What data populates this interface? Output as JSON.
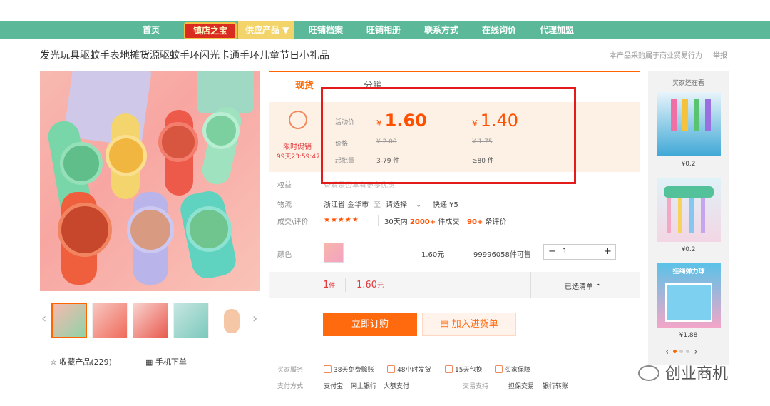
{
  "nav": {
    "home": "首页",
    "shop_treasure": "镇店之宝",
    "supply": "供应产品 ▼",
    "archive": "旺铺档案",
    "album": "旺铺相册",
    "contact": "联系方式",
    "inquiry": "在线询价",
    "agent": "代理加盟"
  },
  "product": {
    "title": "发光玩具驱蚊手表地摊货源驱蚊手环闪光卡通手环儿童节日小礼品",
    "note": "本产品采购属于商业贸易行为",
    "report": "举报"
  },
  "tabs": {
    "current": "现货",
    "distribution": "分销"
  },
  "promo": {
    "label": "限时促销",
    "countdown": "99天23:59:47"
  },
  "pricing": {
    "activity_label": "活动价",
    "price_label": "价格",
    "moq_label": "起批量",
    "yen": "¥",
    "tier1_price": "1.60",
    "tier2_price": "1.40",
    "tier1_orig": "¥ 2.00",
    "tier2_orig": "¥ 1.75",
    "tier1_qty": "3-79 件",
    "tier2_qty": "≥80 件"
  },
  "details": {
    "rights_label": "权益",
    "rights_text": "查看是否享有更多优惠",
    "logistics_label": "物流",
    "origin": "浙江省 金华市",
    "to": "至",
    "select": "请选择",
    "express": "快递 ¥5",
    "deal_label": "成交\\评价",
    "stars": "★★★★★",
    "days30": "30天内",
    "deal_count": "2000+",
    "deal_unit": "件成交",
    "review_count": "90+",
    "review_unit": "条评价"
  },
  "sku": {
    "color_label": "颜色",
    "price": "1.60元",
    "stock": "99996058件可售",
    "qty": "1",
    "minus": "−",
    "plus": "+"
  },
  "summary": {
    "qty": "1",
    "qty_unit": "件",
    "price": "1.60",
    "price_unit": "元",
    "list": "已选清单 ⌃"
  },
  "actions": {
    "buy": "立即订购",
    "cart": "加入进货单"
  },
  "bottom": {
    "favorite": "收藏产品(229)",
    "mobile": "手机下单"
  },
  "services": {
    "buyer_label": "买家服务",
    "s1": "38天免费赊账",
    "s2": "48小时发货",
    "s3": "15天包换",
    "s4": "买家保障",
    "pay_label": "支付方式",
    "p1": "支付宝",
    "p2": "网上银行",
    "p3": "大额支付",
    "trade_label": "交易支持",
    "t1": "担保交易",
    "t2": "银行转账"
  },
  "sidebar": {
    "title": "买家还在看",
    "items": [
      {
        "price": "¥0.2"
      },
      {
        "price": "¥0.2"
      },
      {
        "price": "¥1.88",
        "banner": "挂绳弹力球"
      }
    ]
  },
  "watermark": "创业商机",
  "colors": {
    "accent": "#ff6600",
    "nav": "#5bb99a",
    "price": "#ff5000",
    "frame": "#e41b1b"
  }
}
